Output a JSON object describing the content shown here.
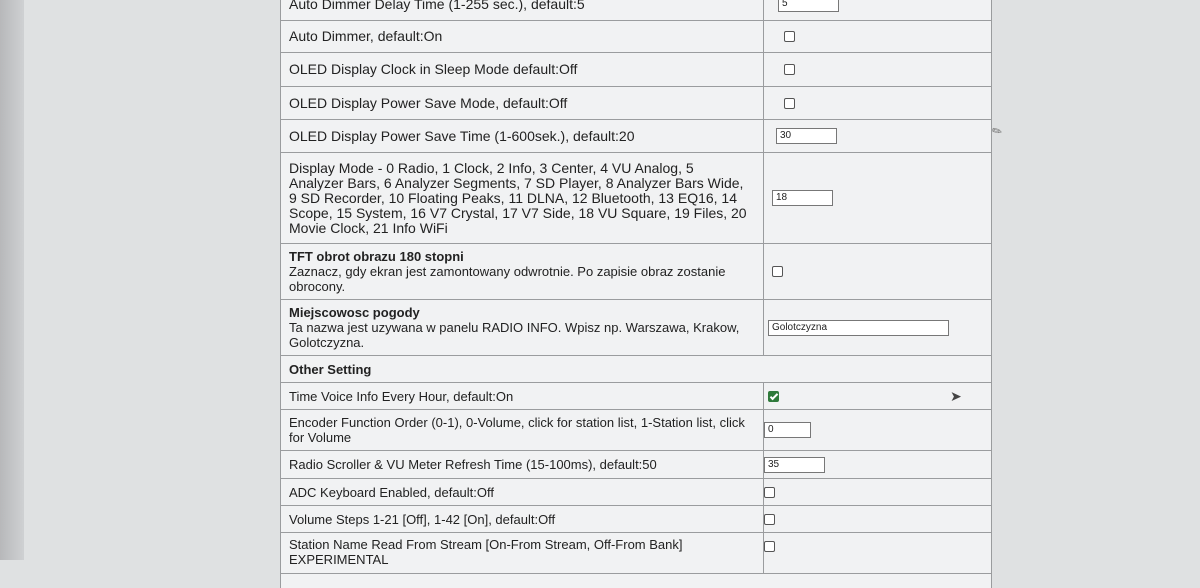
{
  "rows": [
    {
      "label": "Auto Dimmer Delay Time (1-255 sec.), default:5",
      "control": "number",
      "value": "5"
    },
    {
      "label": "Auto Dimmer, default:On",
      "control": "checkbox",
      "checked": false
    },
    {
      "label": "OLED Display Clock in Sleep Mode default:Off",
      "control": "checkbox",
      "checked": false
    },
    {
      "label": "OLED Display Power Save Mode, default:Off",
      "control": "checkbox",
      "checked": false
    },
    {
      "label": "OLED Display Power Save Time (1-600sek.), default:20",
      "control": "number",
      "value": "30"
    },
    {
      "label": "Display Mode - 0 Radio, 1 Clock, 2 Info, 3 Center, 4 VU Analog, 5 Analyzer Bars, 6 Analyzer Segments, 7 SD Player, 8 Analyzer Bars Wide, 9 SD Recorder, 10 Floating Peaks, 11 DLNA, 12 Bluetooth, 13 EQ16, 14 Scope, 15 System, 16 V7 Crystal, 17 V7 Side, 18 VU Square, 19 Files, 20 Movie Clock, 21 Info WiFi",
      "control": "number",
      "value": "18"
    },
    {
      "title": "TFT obrot obrazu 180 stopni",
      "label": "Zaznacz, gdy ekran jest zamontowany odwrotnie. Po zapisie obraz zostanie obrocony.",
      "control": "checkbox",
      "checked": false
    },
    {
      "title": "Miejscowosc pogody",
      "label": "Ta nazwa jest uzywana w panelu RADIO INFO. Wpisz np. Warszawa, Krakow, Golotczyzna.",
      "control": "text",
      "value": "Golotczyzna"
    },
    {
      "section": "Other Setting"
    },
    {
      "label": "Time Voice Info Every Hour, default:On",
      "control": "checkbox",
      "checked": true
    },
    {
      "label": "Encoder Function Order (0-1), 0-Volume, click for station list, 1-Station list, click for Volume",
      "control": "number",
      "value": "0"
    },
    {
      "label": "Radio Scroller & VU Meter Refresh Time (15-100ms), default:50",
      "control": "number",
      "value": "35"
    },
    {
      "label": "ADC Keyboard Enabled, default:Off",
      "control": "checkbox",
      "checked": false
    },
    {
      "label": "Volume Steps 1-21 [Off], 1-42 [On], default:Off",
      "control": "checkbox",
      "checked": false
    },
    {
      "label": "Station Name Read From Stream [On-From Stream, Off-From Bank] EXPERIMENTAL",
      "control": "checkbox",
      "checked": false
    }
  ]
}
